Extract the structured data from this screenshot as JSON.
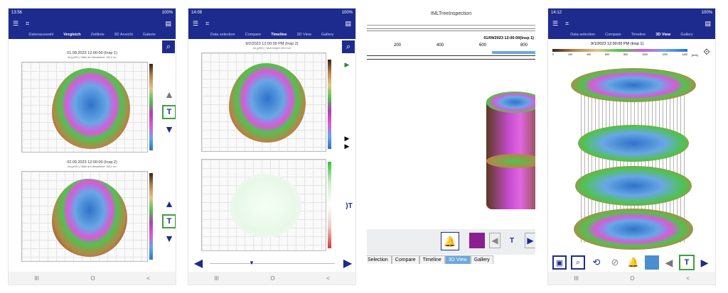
{
  "panel1": {
    "status_time": "13:56",
    "status_battery": "100%",
    "tabs": [
      "Datenauswahl",
      "Vergleich",
      "Zeitlinie",
      "3D Ansicht",
      "Galerie"
    ],
    "active_tab": "Vergleich",
    "plot1_title": "01.09.2023 12:00:00 (Insp 1)",
    "plot1_sub": "dd (μ/HIC) / Mitte der Messebene: 150,0 cm",
    "plot2_title": "02.09.2023 12:00:00 (Insp 2)",
    "plot2_sub": "dd (μ/HIC) / Mitte der Messebene: 150,0 cm",
    "nav": [
      "III",
      "O",
      "<"
    ]
  },
  "panel2": {
    "status_time": "14:08",
    "status_battery": "100%",
    "tabs": [
      "Data selection",
      "Compare",
      "Timeline",
      "3D View",
      "Gallery"
    ],
    "active_tab": "Timeline",
    "plot1_title": "9/2/2023 12:00:00 PM (Insp 2)",
    "plot1_sub": "dd (μ/HIC) / level height: 150,0 cm",
    "nav": [
      "III",
      "O",
      "<"
    ]
  },
  "panel3": {
    "app_title": "IMLTreeInspection",
    "timestamp": "01/09/2023 12:00:00(Insp 1)",
    "ruler": [
      "200",
      "400",
      "600",
      "800"
    ],
    "tabs": [
      "Selection",
      "Compare",
      "Timeline",
      "3D View",
      "Gallery"
    ],
    "active_tab": "3D View"
  },
  "panel4": {
    "status_time": "14:12",
    "status_battery": "100%",
    "tabs": [
      "Data selection",
      "Compare",
      "Timeline",
      "3D View",
      "Gallery"
    ],
    "active_tab": "3D View",
    "timestamp": "9/1/2023 12:00:00 PM (Insp 1)",
    "scale": [
      "0",
      "200",
      "400",
      "600",
      "800",
      "1000",
      "1200",
      "1400"
    ],
    "scale_unit": "[m/s]",
    "nav": [
      "III",
      "O",
      "<"
    ]
  }
}
